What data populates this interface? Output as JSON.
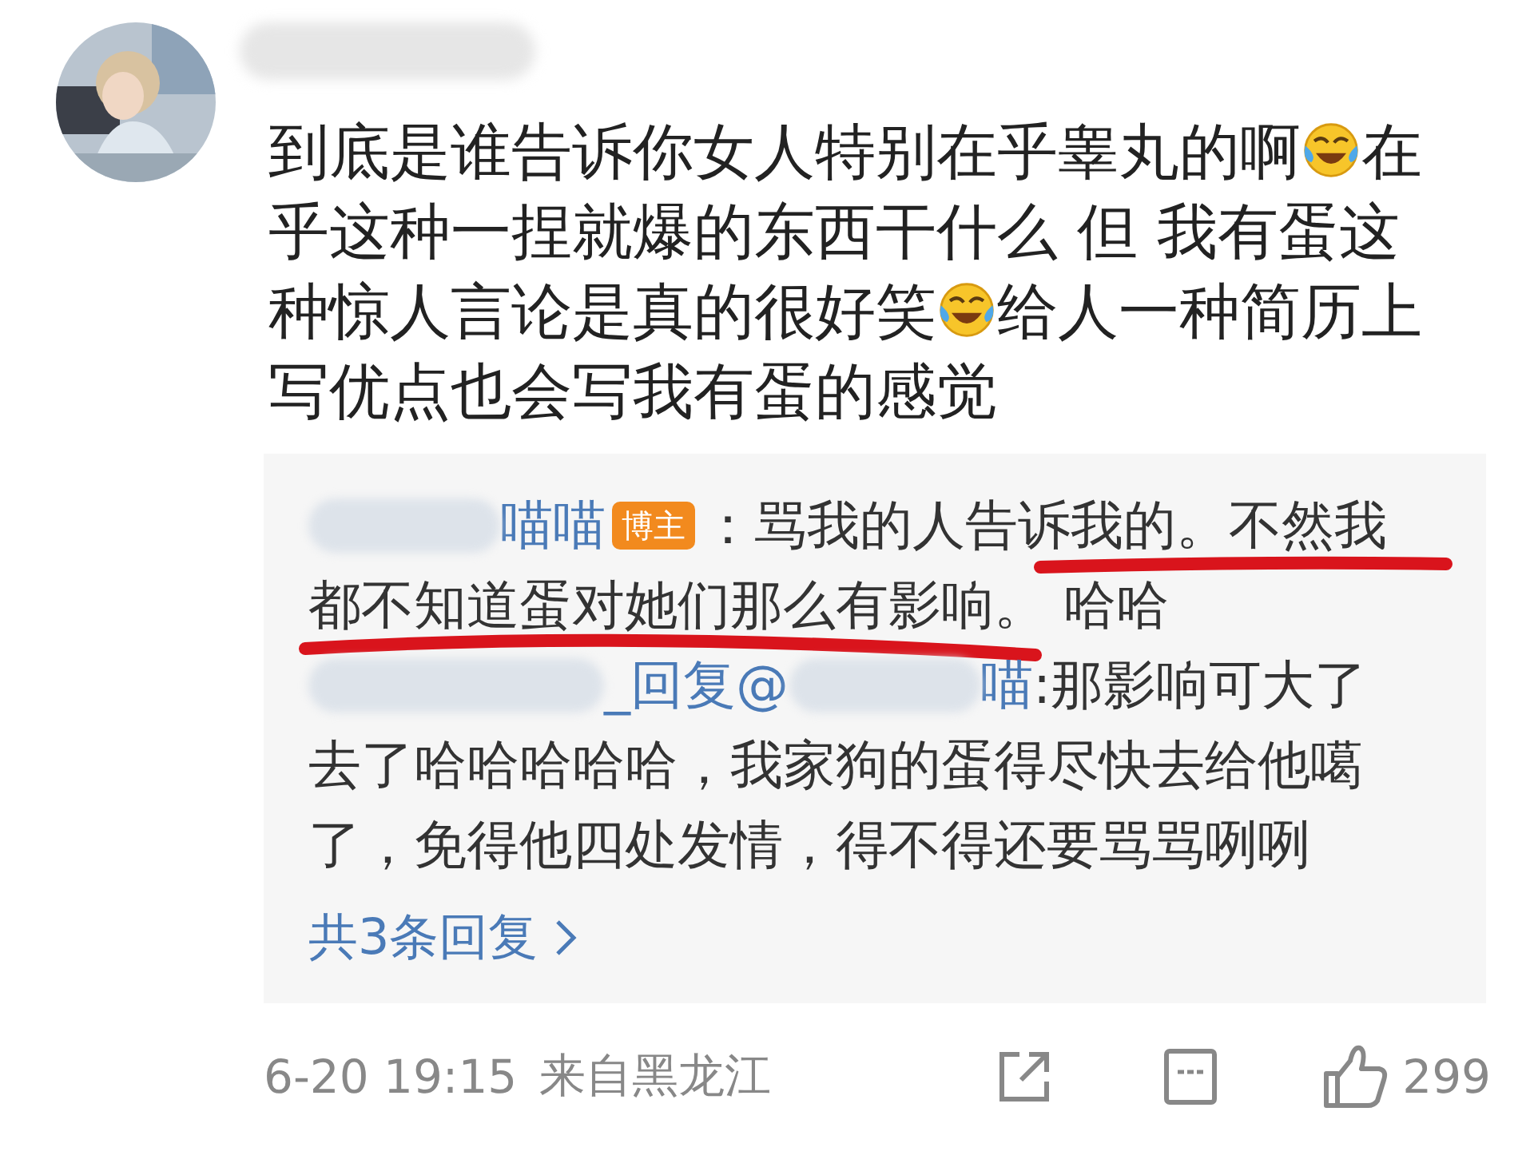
{
  "comment": {
    "avatar": {
      "kind": "picture"
    },
    "author": [
      {
        "kind": "blur_wide"
      }
    ],
    "lines": [
      [
        {
          "kind": "text",
          "text": "到底是谁告诉你女人特别在乎睾丸的啊"
        },
        {
          "kind": "emoji"
        },
        {
          "kind": "text",
          "text": "在"
        }
      ],
      [
        {
          "kind": "text",
          "text": "乎这种一捏就爆的东西干什么 但 我有蛋这"
        }
      ],
      [
        {
          "kind": "text",
          "text": "种惊人言论是真的很好笑"
        },
        {
          "kind": "emoji"
        },
        {
          "kind": "text",
          "text": "给人一种简历上"
        }
      ],
      [
        {
          "kind": "text",
          "text": "写优点也会写我有蛋的感觉"
        }
      ]
    ],
    "replies": [
      {
        "marked": true,
        "lines": [
          [
            {
              "kind": "blur"
            },
            {
              "kind": "name",
              "text": "喵喵"
            },
            {
              "kind": "badge",
              "text": "博主"
            },
            {
              "kind": "text",
              "text": "：骂我的人告诉我的。不然我"
            }
          ],
          [
            {
              "kind": "text",
              "text": "都不知道蛋对她们那么有影响。 哈哈"
            }
          ]
        ]
      },
      {
        "marked": false,
        "lines": [
          [
            {
              "kind": "blur_wide"
            },
            {
              "kind": "name",
              "text": "_回复@"
            },
            {
              "kind": "blur"
            },
            {
              "kind": "name",
              "text": "喵"
            },
            {
              "kind": "text",
              "text": ":那影响可大了"
            }
          ],
          [
            {
              "kind": "text",
              "text": "去了哈哈哈哈哈，我家狗的蛋得尽快去给他噶"
            }
          ],
          [
            {
              "kind": "text",
              "text": "了，免得他四处发情，得不得还要骂骂咧咧"
            }
          ]
        ]
      }
    ],
    "more_replies": "共3条回复",
    "time": "6-20 19:15",
    "location": "来自黑龙江",
    "likes": "299"
  }
}
